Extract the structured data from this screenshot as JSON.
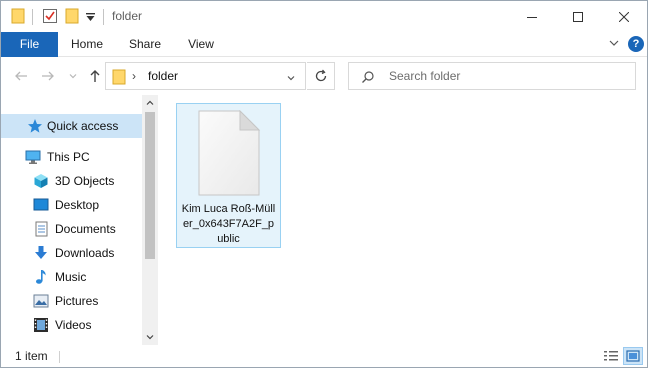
{
  "window": {
    "title": "folder",
    "controls": [
      "minimize",
      "maximize",
      "close"
    ]
  },
  "quick_access_toolbar": {
    "icons": [
      "folder-icon",
      "properties-checkmark-icon",
      "new-folder-icon",
      "customize-dropdown-icon"
    ]
  },
  "ribbon": {
    "tabs": [
      {
        "label": "File",
        "active": true
      },
      {
        "label": "Home"
      },
      {
        "label": "Share"
      },
      {
        "label": "View"
      }
    ],
    "help_label": "?"
  },
  "address": {
    "path": "folder",
    "search_placeholder": "Search folder"
  },
  "nav": {
    "items": [
      {
        "label": "Quick access",
        "icon": "star-icon",
        "selected": true
      },
      {
        "label": "This PC",
        "icon": "pc-icon"
      },
      {
        "label": "3D Objects",
        "icon": "cube-icon"
      },
      {
        "label": "Desktop",
        "icon": "desktop-icon"
      },
      {
        "label": "Documents",
        "icon": "documents-icon"
      },
      {
        "label": "Downloads",
        "icon": "download-arrow-icon"
      },
      {
        "label": "Music",
        "icon": "music-note-icon"
      },
      {
        "label": "Pictures",
        "icon": "pictures-icon"
      },
      {
        "label": "Videos",
        "icon": "film-icon"
      }
    ]
  },
  "content": {
    "files": [
      {
        "name": "Kim Luca Roß-Müller_0x643F7A2F_public",
        "icon": "blank-file-icon",
        "selected": true
      }
    ]
  },
  "status": {
    "item_count": "1 item"
  },
  "colors": {
    "accent": "#1a66b8",
    "selection": "#cce4f7",
    "tile_border": "#99d1f2"
  }
}
